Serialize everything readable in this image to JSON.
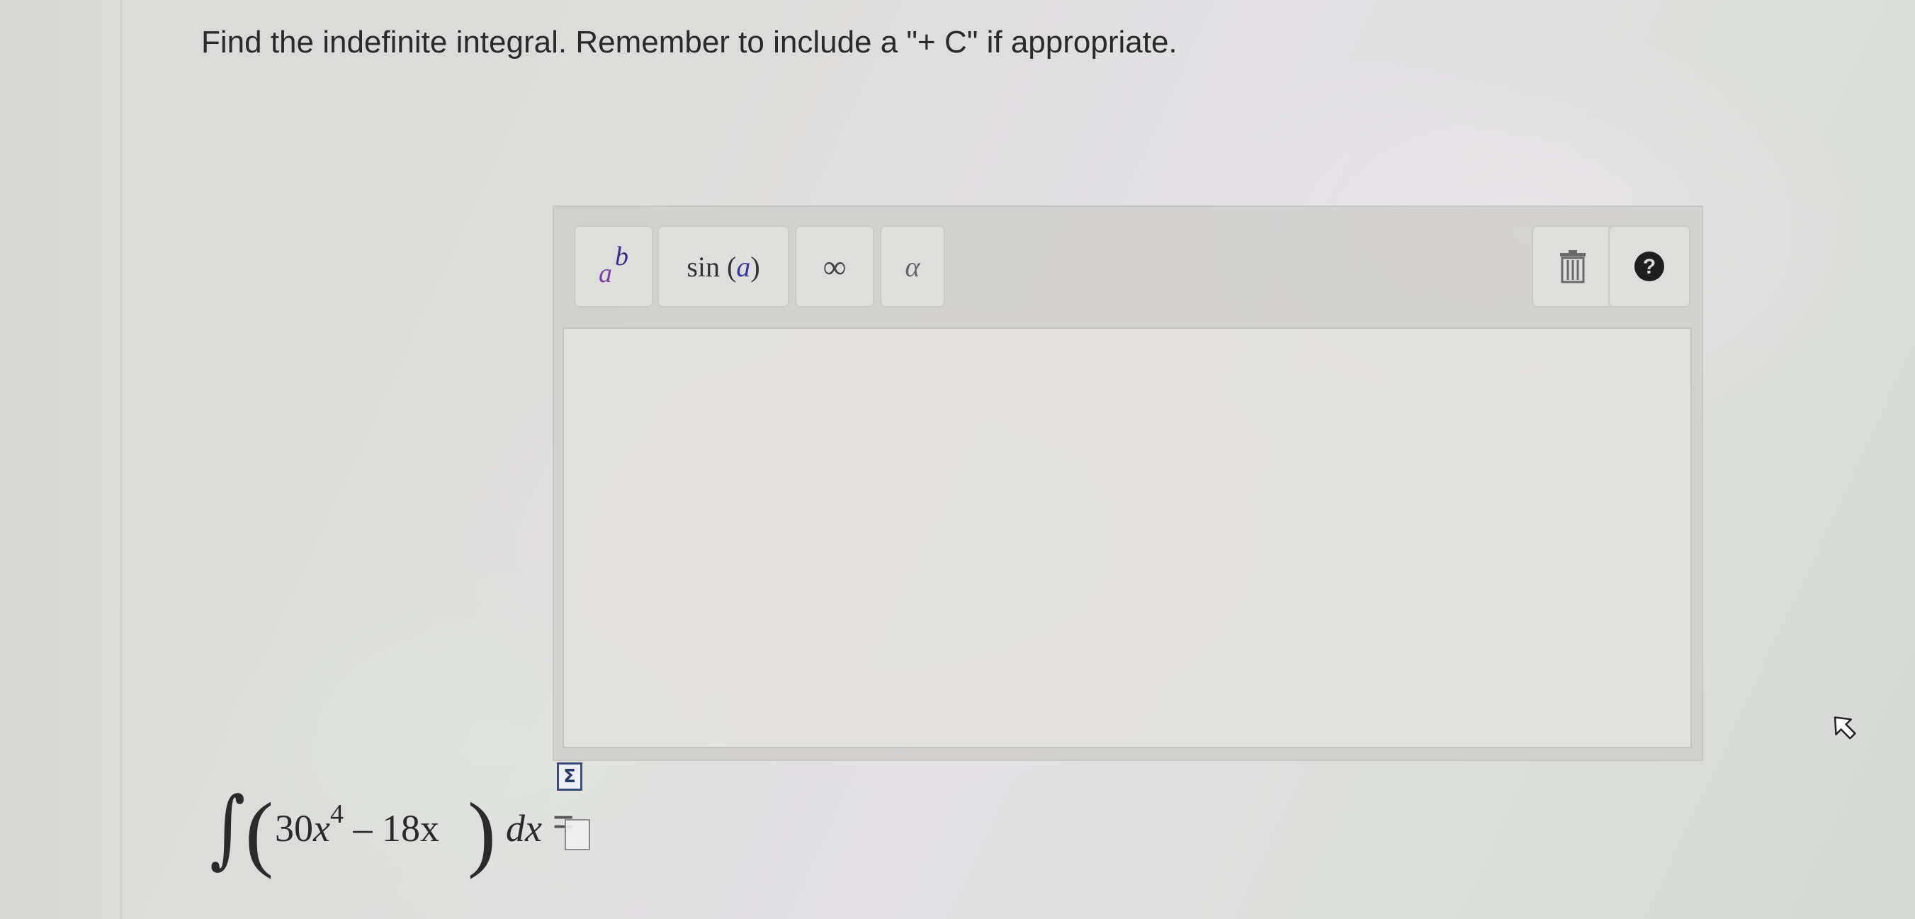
{
  "prompt": {
    "instruction": "Find the indefinite integral. Remember to include a \"+ C\" if appropriate."
  },
  "toolbar": {
    "exponent": {
      "base": "a",
      "sup": "b"
    },
    "sin": {
      "prefix": "sin",
      "open": "(",
      "arg": "a",
      "close": ")"
    },
    "infinity": "∞",
    "alpha": "α",
    "trash_icon": "trash-icon",
    "help_icon": "help-icon",
    "help_glyph": "?"
  },
  "answer": {
    "value": ""
  },
  "problem": {
    "integral_sign": "∫",
    "paren_open": "(",
    "paren_close": ")",
    "coef": "30",
    "var": "x",
    "power": "4",
    "rest": " – 18x",
    "dx": "dx",
    "equals": "="
  },
  "icons": {
    "sum": "Σ",
    "cursor": "mouse-cursor-icon"
  },
  "colors": {
    "help_button": "#1e1e1e",
    "exponent_base": "#7a3fa0",
    "exponent_sup": "#3a2e8f"
  }
}
